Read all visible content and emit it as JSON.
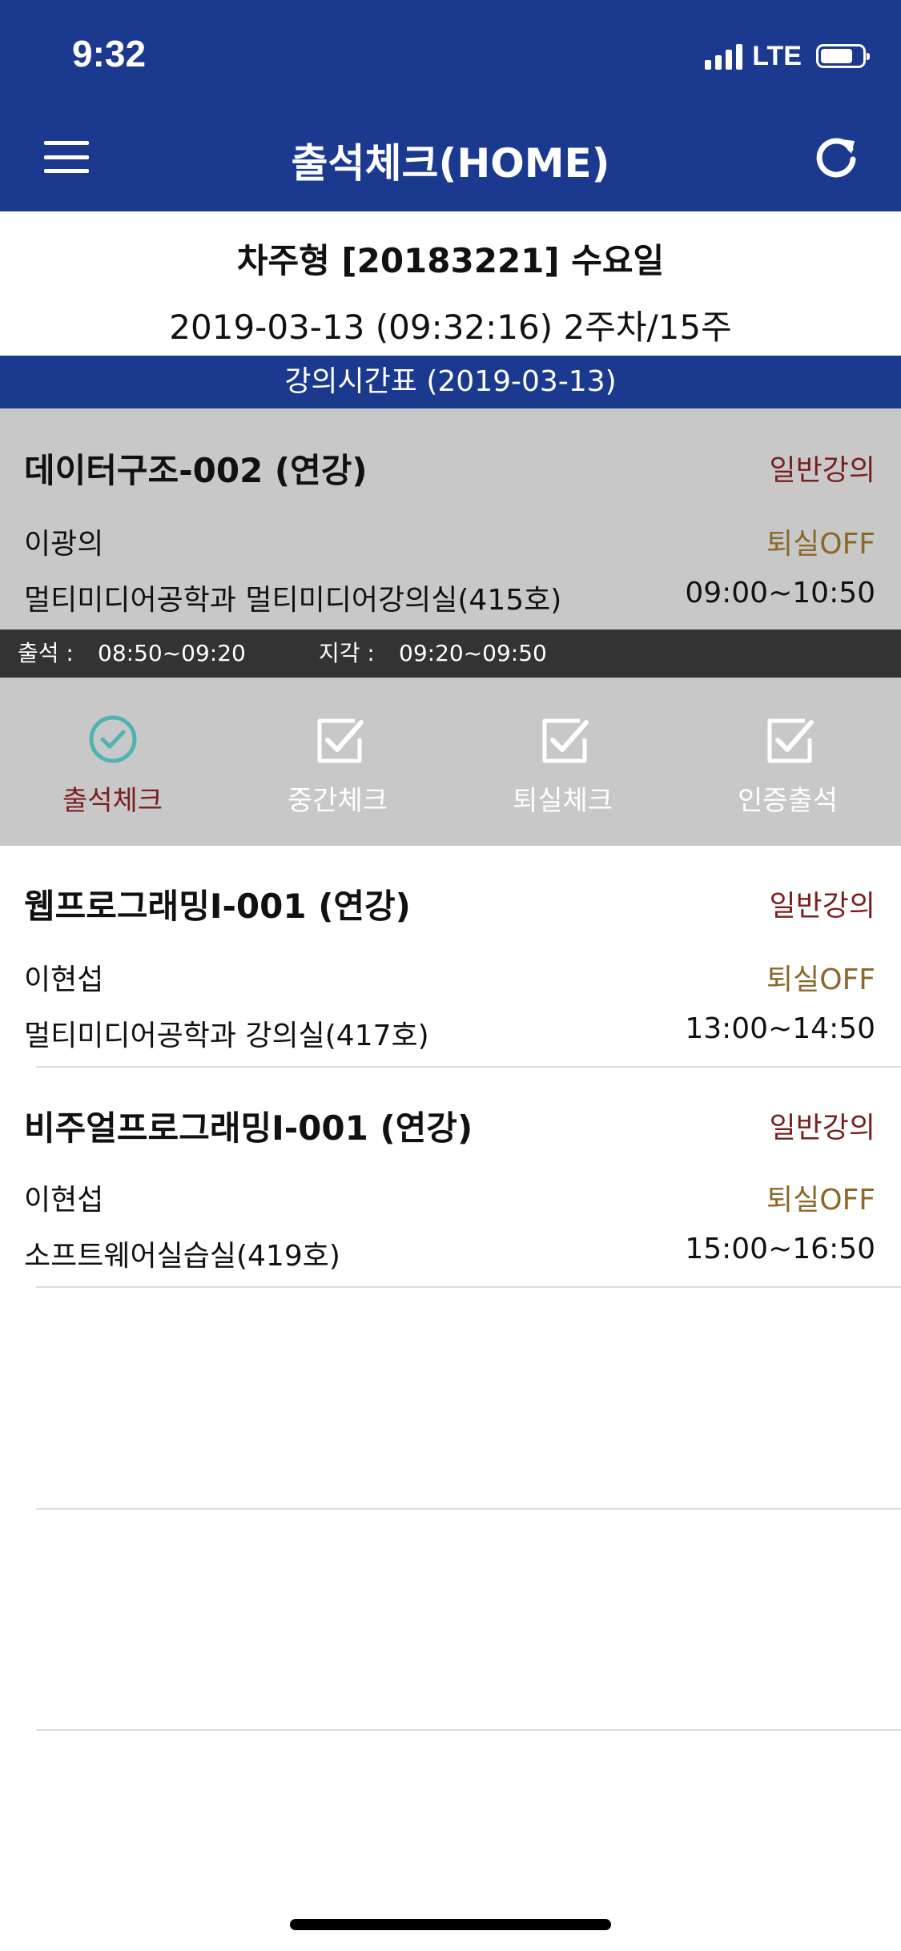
{
  "status_bar": {
    "time": "9:32",
    "network": "LTE"
  },
  "header": {
    "title": "출석체크(HOME)",
    "menu_icon": "hamburger-menu-icon",
    "refresh_icon": "refresh-icon"
  },
  "user": {
    "line": "차주형 [20183221] 수요일",
    "date_line": "2019-03-13 (09:32:16) 2주차/15주"
  },
  "timetable": {
    "title": "강의시간표 (2019-03-13)"
  },
  "courses": [
    {
      "name": "데이터구조-002 (연강)",
      "type": "일반강의",
      "professor": "이광의",
      "exit": "퇴실OFF",
      "room": "멀티미디어공학과 멀티미디어강의실(415호)",
      "time": "09:00~10:50"
    },
    {
      "name": "웹프로그래밍Ⅰ-001 (연강)",
      "type": "일반강의",
      "professor": "이현섭",
      "exit": "퇴실OFF",
      "room": "멀티미디어공학과 강의실(417호)",
      "time": "13:00~14:50"
    },
    {
      "name": "비주얼프로그래밍Ⅰ-001 (연강)",
      "type": "일반강의",
      "professor": "이현섭",
      "exit": "퇴실OFF",
      "room": "소프트웨어실습실(419호)",
      "time": "15:00~16:50"
    }
  ],
  "attendance_window": {
    "attend_label": "출석 :",
    "attend_time": "08:50~09:20",
    "late_label": "지각 :",
    "late_time": "09:20~09:50"
  },
  "check_buttons": [
    {
      "label": "출석체크",
      "icon": "check-circle-icon",
      "active": true
    },
    {
      "label": "중간체크",
      "icon": "checkbox-icon",
      "active": false
    },
    {
      "label": "퇴실체크",
      "icon": "checkbox-icon",
      "active": false
    },
    {
      "label": "인증출석",
      "icon": "checkbox-icon",
      "active": false
    }
  ],
  "colors": {
    "header_blue": "#1b3a8f",
    "active_gray": "#c8c8c8",
    "lecture_type_red": "#7a1f1f",
    "exit_gold": "#8a6a2c",
    "check_teal": "#4fb3b1"
  }
}
